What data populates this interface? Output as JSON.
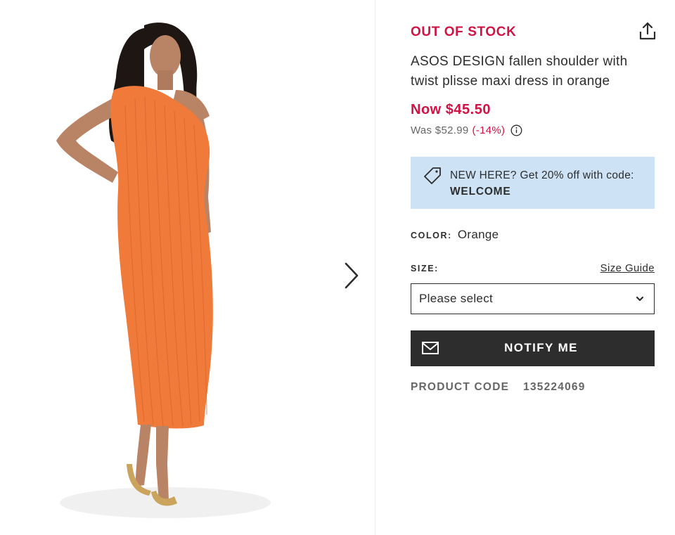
{
  "gallery": {
    "image_alt": "Model wearing an orange one-shoulder plisse maxi dress with gold sandals",
    "next_icon": "chevron-right-icon"
  },
  "product": {
    "stock_status": "OUT OF STOCK",
    "title": "ASOS DESIGN fallen shoulder with twist plisse maxi dress in orange",
    "share_icon": "share-icon",
    "price_now": "Now $45.50",
    "price_was": "Was $52.99",
    "discount": "(-14%)",
    "info_icon": "info-icon"
  },
  "promo": {
    "icon": "tag-icon",
    "text": "NEW HERE? Get 20% off with code:",
    "code": "WELCOME"
  },
  "color": {
    "label": "COLOR:",
    "value": "Orange"
  },
  "size": {
    "label": "SIZE:",
    "guide_link": "Size Guide",
    "selected": "Please select"
  },
  "notify": {
    "label": "NOTIFY ME",
    "icon": "mail-icon"
  },
  "product_code": {
    "label": "PRODUCT CODE",
    "value": "135224069"
  },
  "colors": {
    "accent_red": "#d01345",
    "text_dark": "#2d2d2d",
    "text_grey": "#666666",
    "promo_bg": "#cde2f5",
    "button_bg": "#2d2d2d",
    "dress_orange": "#f07a3a"
  }
}
